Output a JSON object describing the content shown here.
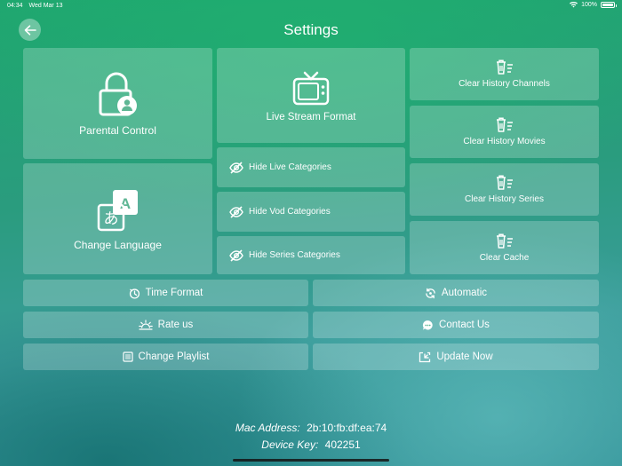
{
  "status_bar": {
    "time": "04:34",
    "date": "Wed Mar 13",
    "battery": "100%"
  },
  "header": {
    "title": "Settings"
  },
  "tiles": {
    "parental_control": "Parental Control",
    "change_language": "Change Language",
    "live_stream_format": "Live Stream Format",
    "hide_live_categories": "Hide Live Categories",
    "hide_vod_categories": "Hide Vod Categories",
    "hide_series_categories": "Hide Series Categories",
    "clear_history_channels": "Clear History Channels",
    "clear_history_movies": "Clear History Movies",
    "clear_history_series": "Clear History Series",
    "clear_cache": "Clear Cache"
  },
  "buttons": {
    "time_format": "Time Format",
    "automatic": "Automatic",
    "rate_us": "Rate us",
    "contact_us": "Contact Us",
    "change_playlist": "Change Playlist",
    "update_now": "Update Now"
  },
  "footer": {
    "mac_label": "Mac Address:",
    "mac_value": "2b:10:fb:df:ea:74",
    "key_label": "Device Key:",
    "key_value": "402251"
  },
  "icons": {
    "back": "back-arrow-icon",
    "wifi": "wifi-icon",
    "battery": "battery-icon",
    "parental": "lock-user-icon",
    "language": "translate-icon",
    "tv": "tv-icon",
    "hide": "eye-off-icon",
    "trash": "trash-list-icon",
    "timer": "timer-icon",
    "auto": "refresh-icon",
    "rate": "sunrise-icon",
    "contact": "chat-icon",
    "playlist": "list-icon",
    "update": "download-icon"
  }
}
